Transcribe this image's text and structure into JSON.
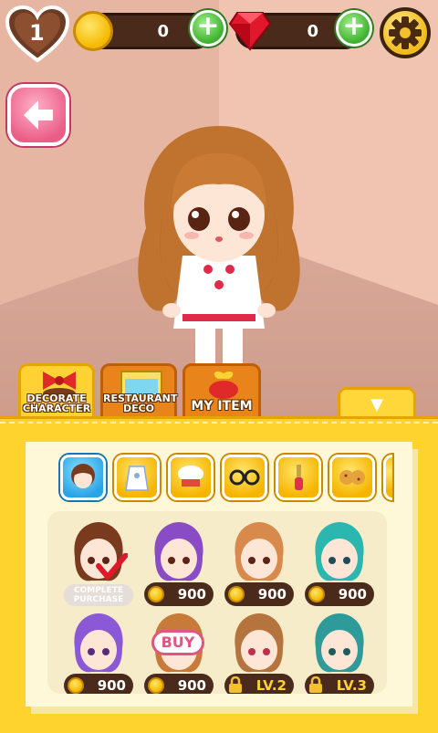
{
  "hud": {
    "hearts": "1",
    "coins": "0",
    "rubies": "0",
    "plus_label": "+"
  },
  "tabs": [
    {
      "label": "DECORATE CHARACTER",
      "active": true
    },
    {
      "label": "RESTAURANT DECO",
      "active": false
    },
    {
      "label": "MY ITEM",
      "active": false
    }
  ],
  "collapse_glyph": "▼",
  "categories": [
    {
      "icon": "hair-icon",
      "active": true
    },
    {
      "icon": "apron-icon",
      "active": false
    },
    {
      "icon": "chef-hat-icon",
      "active": false
    },
    {
      "icon": "glasses-icon",
      "active": false
    },
    {
      "icon": "spatula-icon",
      "active": false
    },
    {
      "icon": "cookies-icon",
      "active": false
    }
  ],
  "items": [
    {
      "hair": "#7a3a1e",
      "status": "COMPLETE PURCHASE"
    },
    {
      "hair": "#8a4cc4",
      "price": "900"
    },
    {
      "hair": "#d8894c",
      "price": "900"
    },
    {
      "hair": "#2bb6b0",
      "price": "900"
    },
    {
      "hair": "#8b58d6",
      "price": "900"
    },
    {
      "hair": "#c87a3a",
      "price": "900",
      "buy_label": "BUY"
    },
    {
      "hair": "#b5743e",
      "lock": "LV.2"
    },
    {
      "hair": "#2e9a9a",
      "lock": "LV.3"
    }
  ],
  "colors": {
    "panel": "#ffd32e",
    "price_pill": "#4a2a1a",
    "buy_accent": "#e05681"
  }
}
